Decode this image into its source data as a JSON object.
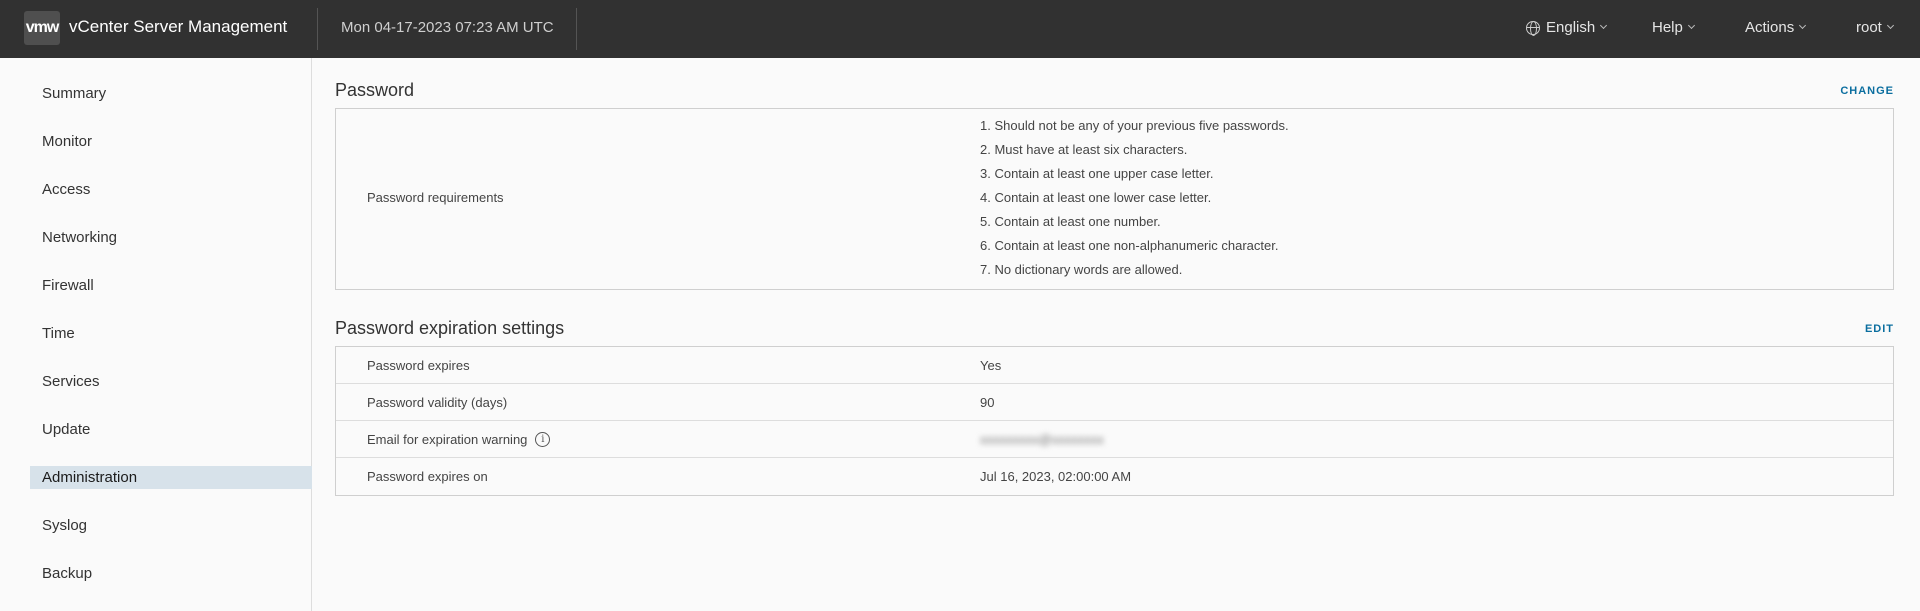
{
  "header": {
    "logo_text": "vmw",
    "app_title": "vCenter Server Management",
    "datetime": "Mon 04-17-2023 07:23 AM UTC",
    "language": "English",
    "help": "Help",
    "actions": "Actions",
    "user": "root"
  },
  "sidebar": {
    "items": [
      {
        "label": "Summary"
      },
      {
        "label": "Monitor"
      },
      {
        "label": "Access"
      },
      {
        "label": "Networking"
      },
      {
        "label": "Firewall"
      },
      {
        "label": "Time"
      },
      {
        "label": "Services"
      },
      {
        "label": "Update"
      },
      {
        "label": "Administration",
        "active": true
      },
      {
        "label": "Syslog"
      },
      {
        "label": "Backup"
      }
    ]
  },
  "password": {
    "title": "Password",
    "change_label": "CHANGE",
    "requirements_label": "Password requirements",
    "requirements": [
      "1. Should not be any of your previous five passwords.",
      "2. Must have at least six characters.",
      "3. Contain at least one upper case letter.",
      "4. Contain at least one lower case letter.",
      "5. Contain at least one number.",
      "6. Contain at least one non-alphanumeric character.",
      "7. No dictionary words are allowed."
    ]
  },
  "expiration": {
    "title": "Password expiration settings",
    "edit_label": "EDIT",
    "rows": [
      {
        "label": "Password expires",
        "value": "Yes"
      },
      {
        "label": "Password validity (days)",
        "value": "90"
      },
      {
        "label": "Email for expiration warning",
        "value": "xxxxxxxxx@xxxxxxxx"
      },
      {
        "label": "Password expires on",
        "value": "Jul 16, 2023, 02:00:00 AM"
      }
    ]
  },
  "colors": {
    "header_bg": "#313131",
    "accent_link": "#0b6e9f",
    "active_nav_bg": "#d7e2ea"
  }
}
